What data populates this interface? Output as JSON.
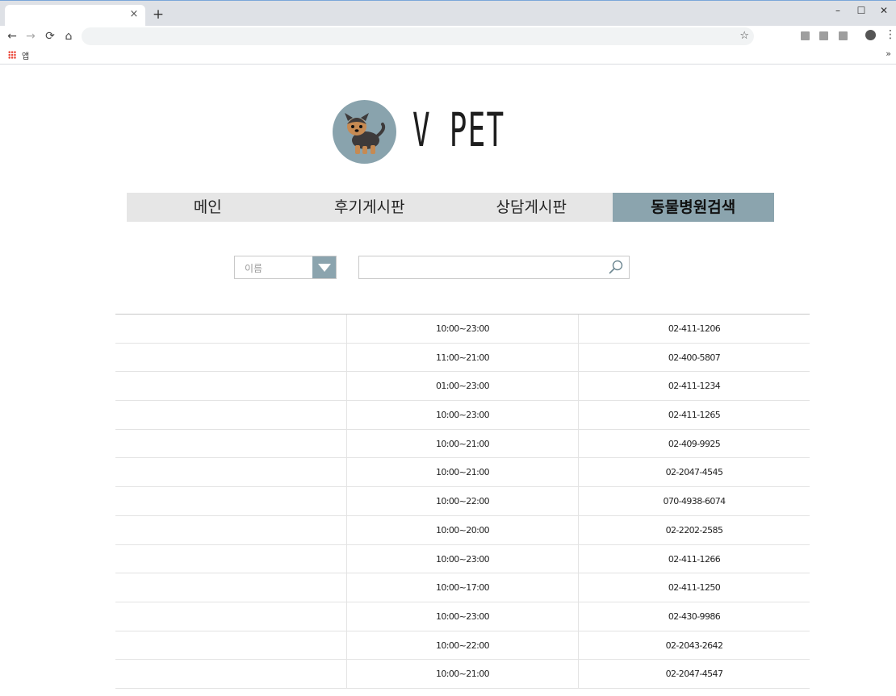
{
  "browser": {
    "new_tab_symbol": "+",
    "close_symbol": "×",
    "window_controls": [
      "–",
      "☐",
      "✕"
    ],
    "nav_symbols": [
      "←",
      "→",
      "⟳",
      "⌂"
    ],
    "star_symbol": "☆",
    "menu_symbol": "⋮",
    "bookmarks_apps_label": "앱",
    "bookmarks_more": "»"
  },
  "logo": {
    "text": "V PET",
    "circle_color": "#89a3ad"
  },
  "gnb": {
    "items": [
      {
        "label": "메인"
      },
      {
        "label": "후기게시판"
      },
      {
        "label": "상담게시판"
      },
      {
        "label": "동물병원검색"
      }
    ],
    "active_index": 3,
    "accent_color": "#8ba4ae"
  },
  "search": {
    "select_value": "이름",
    "input_value": "",
    "icon": "search-icon"
  },
  "hospitals": {
    "rows": [
      {
        "name": "",
        "hours": "10:00~23:00",
        "phone": "02-411-1206"
      },
      {
        "name": "",
        "hours": "11:00~21:00",
        "phone": "02-400-5807"
      },
      {
        "name": "",
        "hours": "01:00~23:00",
        "phone": "02-411-1234"
      },
      {
        "name": "",
        "hours": "10:00~23:00",
        "phone": "02-411-1265"
      },
      {
        "name": "",
        "hours": "10:00~21:00",
        "phone": "02-409-9925"
      },
      {
        "name": "",
        "hours": "10:00~21:00",
        "phone": "02-2047-4545"
      },
      {
        "name": "",
        "hours": "10:00~22:00",
        "phone": "070-4938-6074"
      },
      {
        "name": "",
        "hours": "10:00~20:00",
        "phone": "02-2202-2585"
      },
      {
        "name": "",
        "hours": "10:00~23:00",
        "phone": "02-411-1266"
      },
      {
        "name": "",
        "hours": "10:00~17:00",
        "phone": "02-411-1250"
      },
      {
        "name": "",
        "hours": "10:00~23:00",
        "phone": "02-430-9986"
      },
      {
        "name": "",
        "hours": "10:00~22:00",
        "phone": "02-2043-2642"
      },
      {
        "name": "",
        "hours": "10:00~21:00",
        "phone": "02-2047-4547"
      }
    ]
  }
}
